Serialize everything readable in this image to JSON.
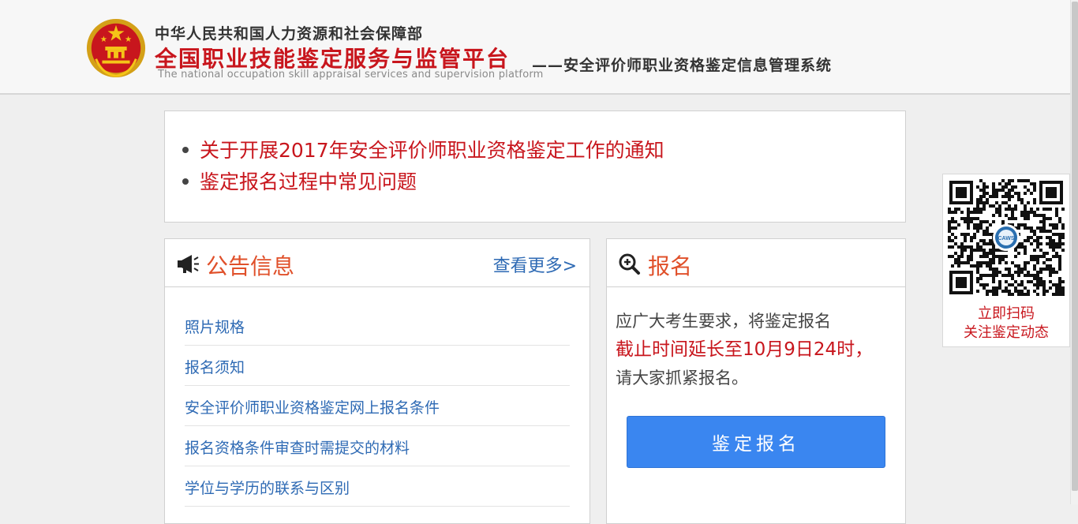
{
  "header": {
    "org": "中华人民共和国人力资源和社会保障部",
    "platform_title": "全国职业技能鉴定服务与监管平台",
    "platform_en": "The national occupation skill appraisal services and supervision platform",
    "system_name": "——安全评价师职业资格鉴定信息管理系统"
  },
  "notices": [
    "关于开展2017年安全评价师职业资格鉴定工作的通知",
    "鉴定报名过程中常见问题"
  ],
  "announcements": {
    "title": "公告信息",
    "more_label": "查看更多>",
    "items": [
      "照片规格",
      "报名须知",
      "安全评价师职业资格鉴定网上报名条件",
      "报名资格条件审查时需提交的材料",
      "学位与学历的联系与区别"
    ]
  },
  "signup": {
    "title": "报名",
    "line1": "应广大考生要求，将鉴定报名",
    "line2": "截止时间延长至10月9日24时，",
    "line3": "请大家抓紧报名。",
    "button_label": "鉴定报名"
  },
  "qr": {
    "line1": "立即扫码",
    "line2": "关注鉴定动态",
    "logo_text": "CAWS"
  },
  "colors": {
    "accent_red": "#c8161d",
    "link_blue": "#2e6ab4",
    "button_blue": "#3a86f0",
    "heading_orange": "#e0502a"
  },
  "icons": {
    "announcement": "megaphone-icon",
    "signup": "magnifier-plus-icon",
    "emblem": "national-emblem-icon"
  }
}
